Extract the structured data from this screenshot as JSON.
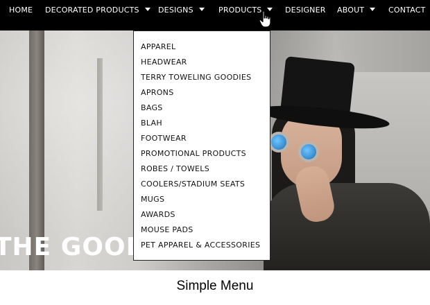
{
  "nav": {
    "items": [
      {
        "label": "HOME",
        "has_caret": false
      },
      {
        "label": "DECORATED PRODUCTS",
        "has_caret": true
      },
      {
        "label": "DESIGNS",
        "has_caret": true
      },
      {
        "label": "PRODUCTS",
        "has_caret": true
      },
      {
        "label": "DESIGNER",
        "has_caret": false
      },
      {
        "label": "ABOUT",
        "has_caret": true
      },
      {
        "label": "CONTACT",
        "has_caret": false
      }
    ],
    "caret_icon": "caret-down-icon",
    "background_color": "#000000",
    "text_color": "#ffffff"
  },
  "dropdown": {
    "items": [
      "APPAREL",
      "HEADWEAR",
      "TERRY TOWELING GOODIES",
      "APRONS",
      "BAGS",
      "BLAH",
      "FOOTWEAR",
      "PROMOTIONAL PRODUCTS",
      "ROBES / TOWELS",
      "COOLERS/STADIUM SEATS",
      "MUGS",
      "AWARDS",
      "MOUSE PADS",
      "PET APPAREL & ACCESSORIES"
    ]
  },
  "hero": {
    "text": "THE GOOD"
  },
  "cursor": {
    "icon": "hand-pointer-icon"
  },
  "caption": "Simple Menu"
}
